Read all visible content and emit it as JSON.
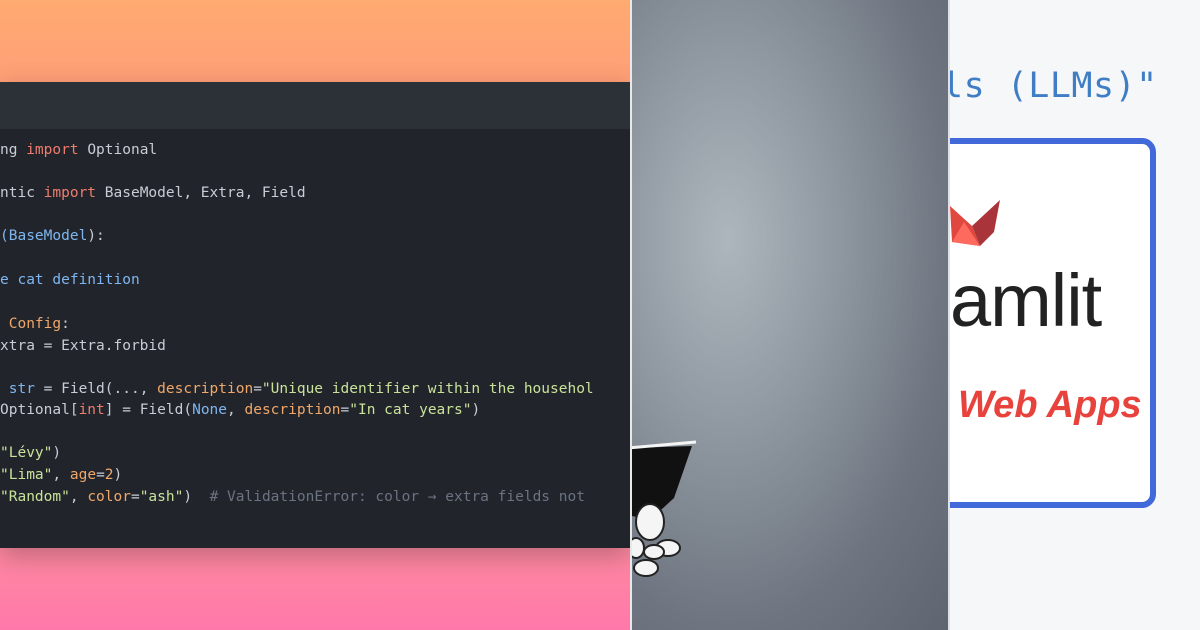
{
  "code_panel": {
    "lines": [
      [
        {
          "t": "ng ",
          "c": "plain"
        },
        {
          "t": "import",
          "c": "kw"
        },
        {
          "t": " Optional",
          "c": "plain"
        }
      ],
      [],
      [
        {
          "t": "ntic ",
          "c": "plain"
        },
        {
          "t": "import",
          "c": "kw"
        },
        {
          "t": " BaseModel, Extra, Field",
          "c": "plain"
        }
      ],
      [],
      [
        {
          "t": "(",
          "c": "cls"
        },
        {
          "t": "BaseModel",
          "c": "cls"
        },
        {
          "t": "):",
          "c": "plain"
        }
      ],
      [],
      [
        {
          "t": "e cat definition",
          "c": "cls"
        }
      ],
      [],
      [
        {
          "t": " Config",
          "c": "par"
        },
        {
          "t": ":",
          "c": "plain"
        }
      ],
      [
        {
          "t": "xtra = Extra.forbid",
          "c": "plain"
        }
      ],
      [],
      [
        {
          "t": " ",
          "c": "plain"
        },
        {
          "t": "str",
          "c": "cls"
        },
        {
          "t": " = Field(..., ",
          "c": "plain"
        },
        {
          "t": "description",
          "c": "par"
        },
        {
          "t": "=",
          "c": "plain"
        },
        {
          "t": "\"Unique identifier within the househol",
          "c": "str"
        }
      ],
      [
        {
          "t": "Optional[",
          "c": "plain"
        },
        {
          "t": "int",
          "c": "kw"
        },
        {
          "t": "] = Field(",
          "c": "plain"
        },
        {
          "t": "None",
          "c": "cls"
        },
        {
          "t": ", ",
          "c": "plain"
        },
        {
          "t": "description",
          "c": "par"
        },
        {
          "t": "=",
          "c": "plain"
        },
        {
          "t": "\"In cat years\"",
          "c": "str"
        },
        {
          "t": ")",
          "c": "plain"
        }
      ],
      [],
      [
        {
          "t": "\"Lévy\"",
          "c": "str"
        },
        {
          "t": ")",
          "c": "plain"
        }
      ],
      [
        {
          "t": "\"Lima\"",
          "c": "str"
        },
        {
          "t": ", ",
          "c": "plain"
        },
        {
          "t": "age",
          "c": "par"
        },
        {
          "t": "=",
          "c": "plain"
        },
        {
          "t": "2",
          "c": "num"
        },
        {
          "t": ")",
          "c": "plain"
        }
      ],
      [
        {
          "t": "\"Random\"",
          "c": "str"
        },
        {
          "t": ", ",
          "c": "plain"
        },
        {
          "t": "color",
          "c": "par"
        },
        {
          "t": "=",
          "c": "plain"
        },
        {
          "t": "\"ash\"",
          "c": "str"
        },
        {
          "t": ")  ",
          "c": "plain"
        },
        {
          "t": "# ValidationError: color → extra fields not",
          "c": "cmt"
        }
      ]
    ]
  },
  "streamlit_panel": {
    "heading": "ls (LLMs)\"",
    "brand": "amlit",
    "tagline": "Web Apps"
  },
  "colors": {
    "code_bg": "#21252b",
    "keyword": "#ef7c6d",
    "string": "#c9e29a",
    "param": "#f0a76a",
    "class": "#7fb6f0",
    "card_border": "#4169d9",
    "tagline": "#e8423d"
  }
}
